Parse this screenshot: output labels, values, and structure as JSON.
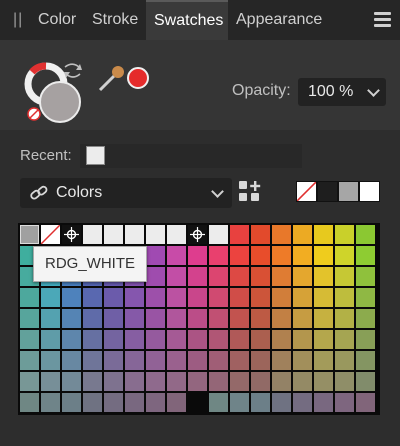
{
  "tabs": [
    {
      "label": "Color"
    },
    {
      "label": "Stroke"
    },
    {
      "label": "Swatches",
      "active": true
    },
    {
      "label": "Appearance"
    }
  ],
  "opacity": {
    "label": "Opacity:",
    "value": "100 %"
  },
  "fill": {
    "color": "#a6a1a1",
    "eyedropper_color": "#e52b2b"
  },
  "recent": {
    "label": "Recent:",
    "swatches": [
      "#ececec"
    ]
  },
  "palette": {
    "selected": "Colors"
  },
  "history_swatches": [
    "none",
    "#1e1e1e",
    "#a6a6a6",
    "#ffffff"
  ],
  "tooltip": {
    "text": "RDG_WHITE"
  },
  "icons": [
    "grip-icon",
    "panel-menu-icon",
    "fill-stroke-icon",
    "swap-icon",
    "eyedropper-icon",
    "link-icon",
    "add-palette-icon",
    "chevron-down-icon",
    "registration-icon",
    "no-color-icon"
  ],
  "special_swatches": [
    {
      "type": "gray",
      "color": "#a0a0a0"
    },
    {
      "type": "none"
    },
    {
      "type": "registration"
    },
    {
      "type": "white"
    },
    {
      "type": "white"
    },
    {
      "type": "white"
    },
    {
      "type": "white"
    },
    {
      "type": "white"
    },
    {
      "type": "registration"
    },
    {
      "type": "white"
    }
  ],
  "swatch_grid": [
    [
      "#3aa8a0",
      "#36b4c6",
      "#3c7fc8",
      "#4a63b8",
      "#5a57b2",
      "#7e4fb4",
      "#9c49b0",
      "#c24aa8",
      "#d93c8e",
      "#e33f6f",
      "#e8413f",
      "#e24a2c",
      "#e8782a",
      "#ecaa23",
      "#e7c91e",
      "#c9d02a",
      "#8bc832",
      "#58bc3c"
    ],
    [
      "#3fae9e",
      "#3ab8c8",
      "#417fca",
      "#4e64ba",
      "#6058b4",
      "#8250b6",
      "#a04ab2",
      "#c84ba8",
      "#de3d8e",
      "#e9406e",
      "#ec433f",
      "#e84d2b",
      "#ee7b28",
      "#f2ad22",
      "#efcc1d",
      "#cfd42a",
      "#8ecc32",
      "#5bbd3d"
    ],
    [
      "#47ab9e",
      "#43aec0",
      "#4880c2",
      "#5466b4",
      "#6659b0",
      "#8452b2",
      "#9f4cae",
      "#c24ea6",
      "#d3428d",
      "#dc4570",
      "#dd4944",
      "#d95034",
      "#df7c33",
      "#e4a72e",
      "#e3c32b",
      "#c6c834",
      "#8fc13c",
      "#62b445"
    ],
    [
      "#4da89d",
      "#4ba8b8",
      "#4e82bc",
      "#5968b0",
      "#6b5bab",
      "#8556ae",
      "#9d50aa",
      "#bb52a2",
      "#c9468b",
      "#d04a71",
      "#d04d48",
      "#cc553a",
      "#d17e3a",
      "#d6a237",
      "#d6bb35",
      "#bebd3d",
      "#8fb844",
      "#66ad4b"
    ],
    [
      "#57a59c",
      "#54a2b0",
      "#5584b4",
      "#5f6ba9",
      "#6f5fa6",
      "#8559a8",
      "#9954a4",
      "#b0569c",
      "#bb4d88",
      "#c15073",
      "#c2534f",
      "#bd5a44",
      "#c28044",
      "#c69c42",
      "#c6b140",
      "#b2b146",
      "#8cab4d",
      "#6ba554"
    ],
    [
      "#62a19b",
      "#5f9ca8",
      "#5e86ac",
      "#6670a2",
      "#7464a0",
      "#865ea2",
      "#955a9e",
      "#a55a95",
      "#ab5484",
      "#b05675",
      "#b05958",
      "#ab5f4f",
      "#b0814f",
      "#b3964d",
      "#b4a74c",
      "#a5a552",
      "#889f57",
      "#6f9d5c"
    ],
    [
      "#6d9c99",
      "#6b96a0",
      "#6888a2",
      "#6f7599",
      "#7a6b98",
      "#866698",
      "#916296",
      "#9a618e",
      "#9d5c82",
      "#a05e76",
      "#a06161",
      "#9c655b",
      "#a0815c",
      "#a28f5b",
      "#a39b5a",
      "#99985e",
      "#849562",
      "#769665"
    ],
    [
      "#789796",
      "#778f98",
      "#738a98",
      "#78798f",
      "#7e728f",
      "#886d8f",
      "#8f6a8d",
      "#926988",
      "#93667f",
      "#946677",
      "#946969",
      "#916a66",
      "#938266",
      "#948a65",
      "#958f65",
      "#8f8e68",
      "#818c6b",
      "#7a8f6d"
    ],
    [
      "#6f8784",
      "#6f8489",
      "#6c7f88",
      "#6f7282",
      "#746c81",
      "#796880",
      "#7e667f",
      "#81657a",
      "#"
    ]
  ]
}
